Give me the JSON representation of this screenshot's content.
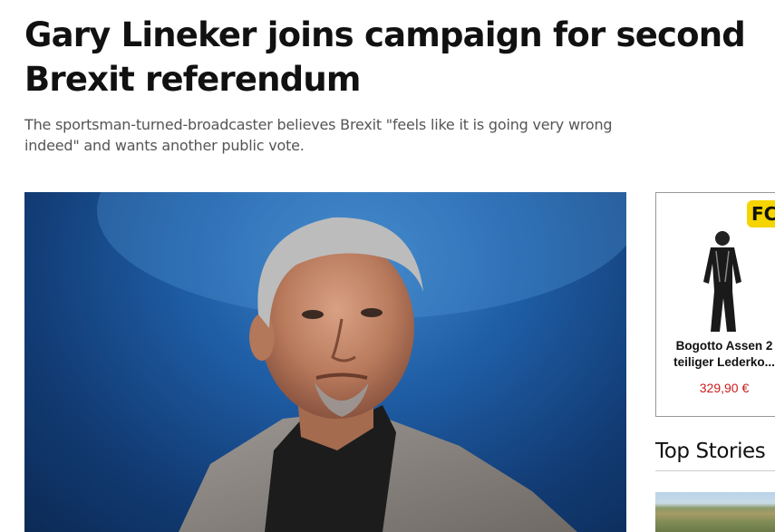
{
  "article": {
    "headline": "Gary Lineker joins campaign for second Brexit referendum",
    "standfirst": "The sportsman-turned-broadcaster believes Brexit \"feels like it is going very wrong indeed\" and wants another public vote."
  },
  "hero_image": {
    "icon": "portrait-photo"
  },
  "ad": {
    "logo_text": "FC",
    "product_name_line1": "Bogotto Assen 2",
    "product_name_line2": "teiliger Lederko...",
    "price": "329,90 €",
    "colors": {
      "price": "#cc1a1a",
      "logo_bg": "#f5d400"
    }
  },
  "sidebar": {
    "top_stories_heading": "Top Stories"
  }
}
